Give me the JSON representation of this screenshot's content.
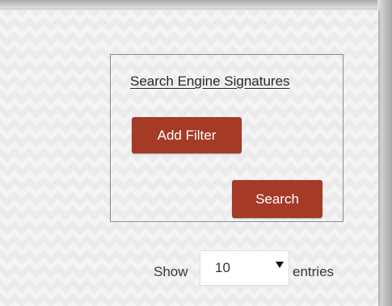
{
  "search_panel": {
    "title": "Search Engine Signatures",
    "add_filter_label": "Add Filter",
    "search_label": "Search"
  },
  "pagination": {
    "show_label": "Show",
    "entries_per_page": "10",
    "entries_label": "entries"
  },
  "colors": {
    "button_background": "#a53a27",
    "button_text": "#ffffff"
  }
}
